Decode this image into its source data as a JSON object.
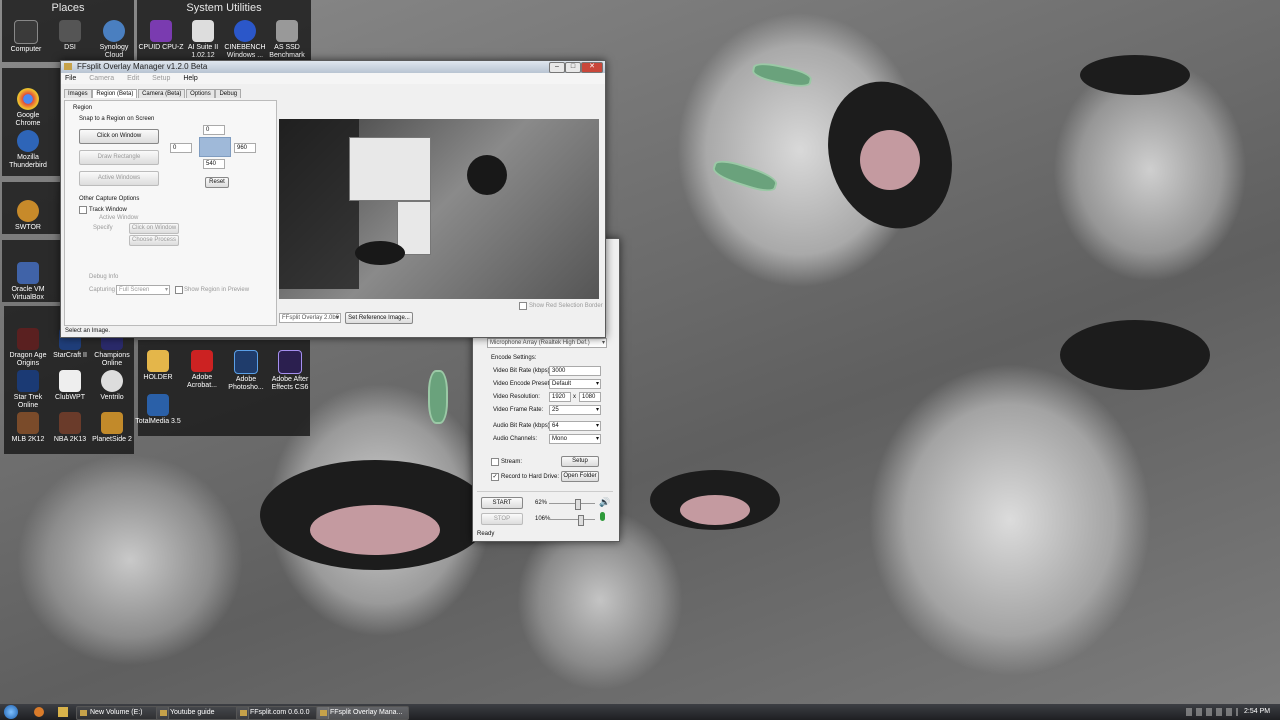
{
  "desktop": {
    "places_title": "Places",
    "system_utilities_title": "System Utilities",
    "places_icons": [
      "Computer",
      "DSI",
      "Synology Cloud"
    ],
    "sysutil_icons": [
      "CPUID CPU-Z",
      "AI Suite II 1.02.12",
      "CINEBENCH Windows ...",
      "AS SSD Benchmark"
    ],
    "left_icons": [
      "Google Chrome",
      "Mozilla Thunderbird",
      "SWTOR",
      "Oracle VM VirtualBox"
    ],
    "games_icons": [
      "Dragon Age Origins",
      "StarCraft II",
      "Champions Online",
      "Star Trek Online",
      "ClubWPT",
      "Ventrilo",
      "MLB 2K12",
      "NBA 2K13",
      "PlanetSide 2"
    ],
    "apps_icons": [
      "HOLDER",
      "Adobe Acrobat...",
      "Adobe Photosho...",
      "Adobe After Effects CS6",
      "TotalMedia 3.5"
    ]
  },
  "overlay_window": {
    "title": "FFsplit Overlay Manager v1.2.0 Beta",
    "menu": [
      "File",
      "Camera",
      "Edit",
      "Setup",
      "Help"
    ],
    "tabs": [
      "Images",
      "Region (Beta)",
      "Camera (Beta)",
      "Options",
      "Debug"
    ],
    "region_label": "Region",
    "snap_label": "Snap to a Region on Screen",
    "click_on_window": "Click on Window",
    "draw_rectangle": "Draw Rectangle",
    "active_windows": "Active Windows",
    "top_value": "0",
    "left_value": "0",
    "width_value": "960",
    "height_value": "540",
    "reset": "Reset",
    "other_options": "Other Capture Options",
    "track_window": "Track Window",
    "active_window": "Active Window",
    "specify": "Specify",
    "click_on_window_2": "Click on Window",
    "choose_process": "Choose Process",
    "debug_info": "Debug Info",
    "capturing": "Capturing",
    "capturing_value": "Full Screen",
    "show_region": "Show Region in Preview",
    "show_red_border": "Show Red Selection Border",
    "overlay_select": "FFsplit Overlay 2.0b0",
    "set_reference": "Set Reference Image...",
    "status": "Select an Image."
  },
  "ffsplit_window": {
    "audio_device": "Microphone Array (Realtek High Def.)",
    "encode_settings": "Encode Settings:",
    "video_bitrate_label": "Video Bit Rate (kbps):",
    "video_bitrate": "3000",
    "encode_preset_label": "Video Encode Preset:",
    "encode_preset": "Default",
    "resolution_label": "Video Resolution:",
    "res_w": "1920",
    "res_x": "x",
    "res_h": "1080",
    "framerate_label": "Video Frame Rate:",
    "framerate": "25",
    "audio_bitrate_label": "Audio Bit Rate (kbps):",
    "audio_bitrate": "64",
    "audio_channels_label": "Audio Channels:",
    "audio_channels": "Mono",
    "stream": "Stream:",
    "setup": "Setup",
    "record": "Record to Hard Drive:",
    "open_folder": "Open Folder",
    "start": "START",
    "stop": "STOP",
    "speaker_vol": "62%",
    "mic_vol": "106%",
    "speaker_level": 0.62,
    "mic_level": 0.7,
    "status": "Ready"
  },
  "taskbar": {
    "tasks": [
      "New Volume (E:)",
      "Youtube guide",
      "FFsplit.com 0.6.0.0",
      "FFsplit Overlay Mana..."
    ],
    "clock": "2:54 PM"
  },
  "colors": {
    "selection_blue": "#9fb9d9",
    "speaker_green": "#2e9a3a"
  }
}
